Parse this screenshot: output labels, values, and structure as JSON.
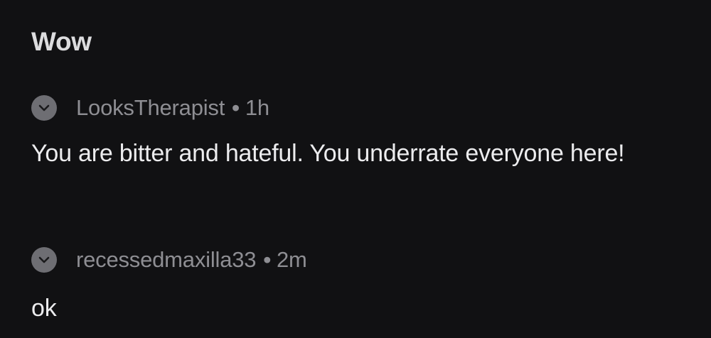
{
  "post": {
    "title": "Wow"
  },
  "comments": [
    {
      "username": "LooksTherapist",
      "separator": "•",
      "time": "1h",
      "body": "You are bitter and hateful. You underrate everyone here!",
      "collapse_icon": "chevron-down-icon"
    },
    {
      "username": "recessedmaxilla33",
      "separator": "•",
      "time": "2m",
      "body": "ok",
      "collapse_icon": "chevron-down-icon"
    }
  ],
  "colors": {
    "background": "#111113",
    "text": "#ececee",
    "meta": "#8e8e93",
    "collapse_button": "#6e6e73"
  }
}
